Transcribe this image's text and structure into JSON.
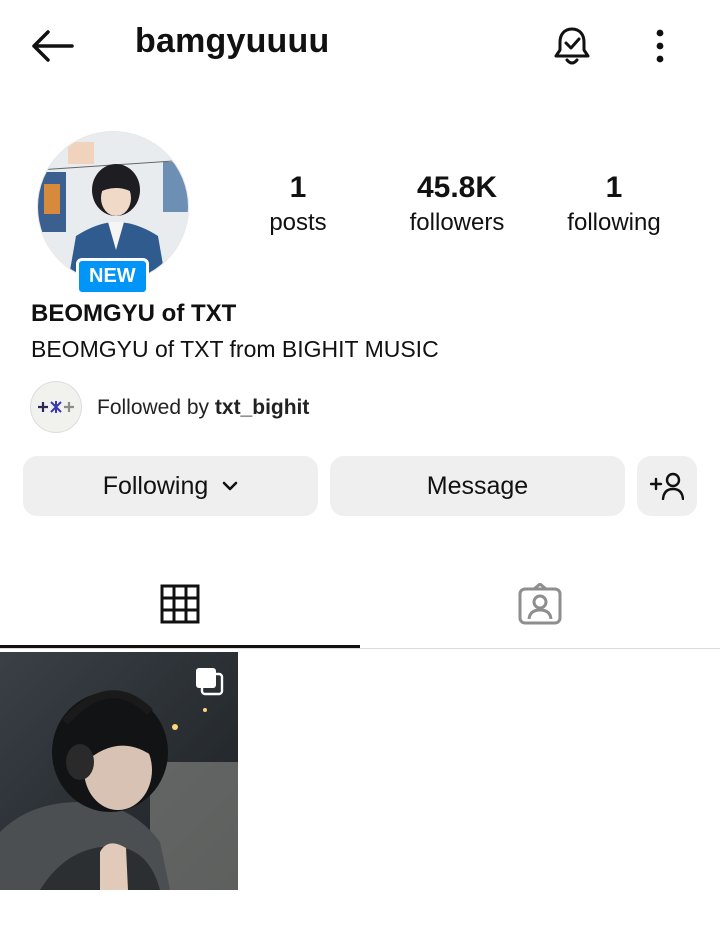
{
  "header": {
    "username": "bamgyuuuu"
  },
  "profile": {
    "badge": "NEW",
    "display_name": "BEOMGYU of TXT",
    "bio": "BEOMGYU of TXT from BIGHIT MUSIC"
  },
  "stats": {
    "posts_count": "1",
    "posts_label": "posts",
    "followers_count": "45.8K",
    "followers_label": "followers",
    "following_count": "1",
    "following_label": "following"
  },
  "followed_by": {
    "prefix": "Followed by ",
    "user": "txt_bighit"
  },
  "actions": {
    "following_label": "Following",
    "message_label": "Message"
  },
  "tabs": {
    "active": "grid"
  },
  "colors": {
    "accent": "#0095f6",
    "button_bg": "#efefef"
  },
  "icons": [
    "back-arrow-icon",
    "bell-check-icon",
    "more-vertical-icon",
    "chevron-down-icon",
    "add-user-icon",
    "grid-icon",
    "tagged-icon",
    "multiple-posts-icon"
  ]
}
